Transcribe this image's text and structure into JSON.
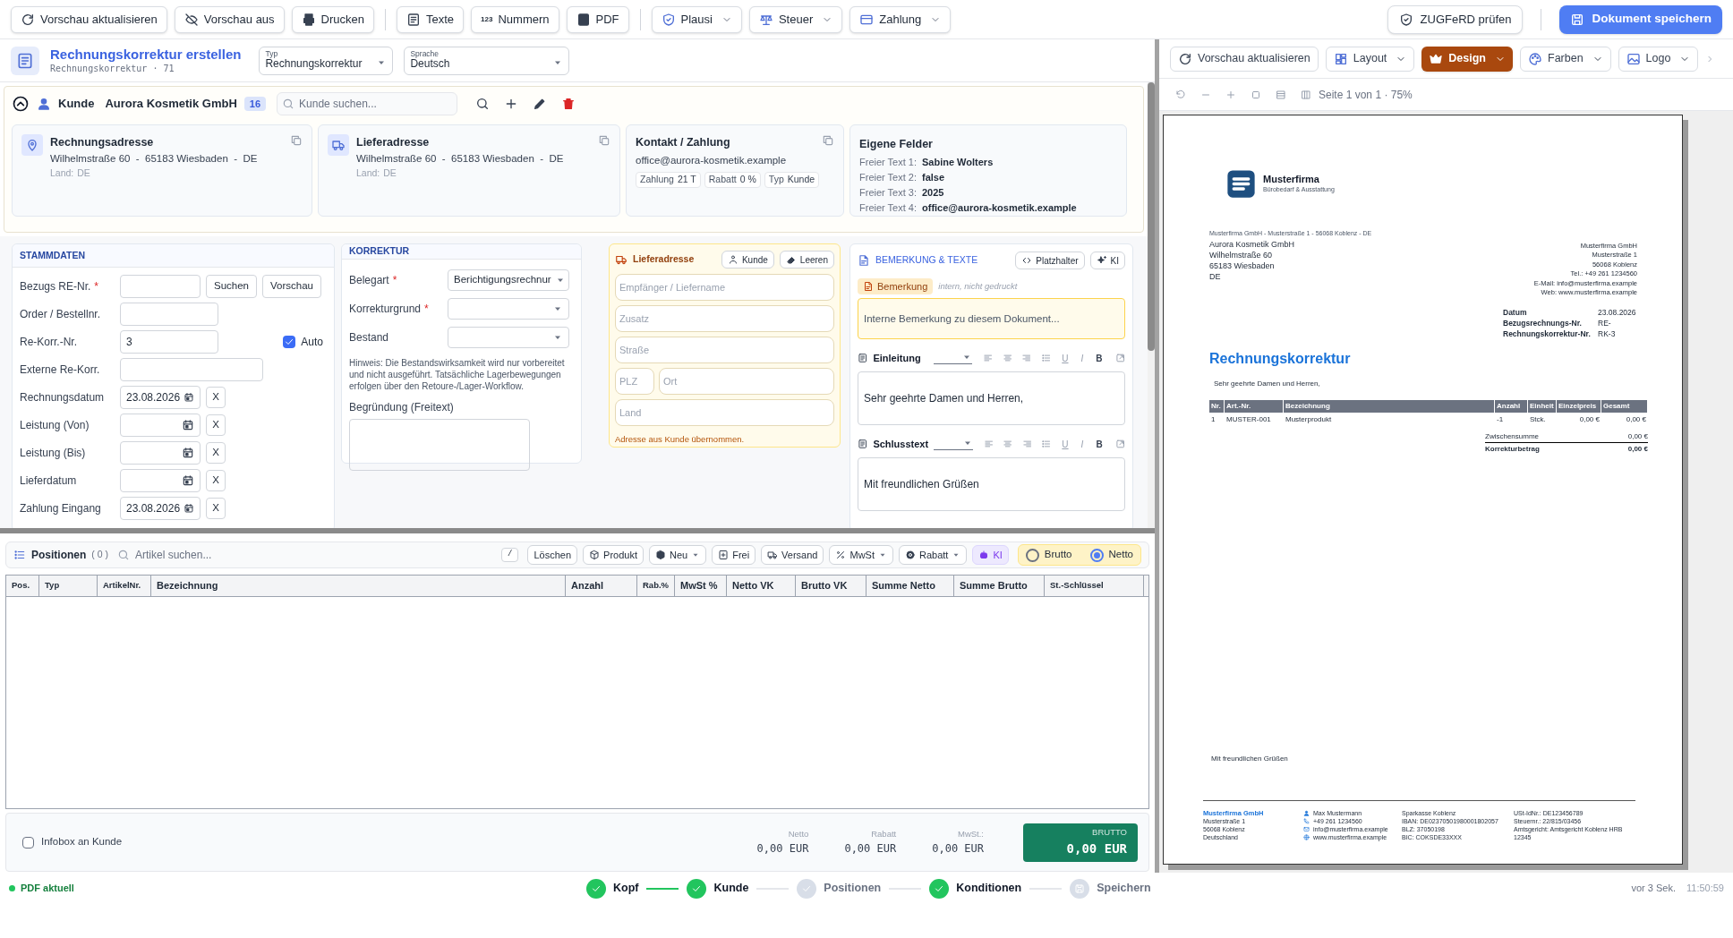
{
  "toolbar": {
    "buttons": [
      {
        "label": "Vorschau aktualisieren",
        "kind": "action"
      },
      {
        "label": "Vorschau aus",
        "kind": "action"
      },
      {
        "label": "Drucken",
        "kind": "action"
      },
      {
        "label": "Texte",
        "kind": "action"
      },
      {
        "label": "Nummern",
        "kind": "action",
        "icon_text": "123"
      },
      {
        "label": "PDF",
        "kind": "action"
      },
      {
        "label": "Plausi",
        "kind": "menu"
      },
      {
        "label": "Steuer",
        "kind": "menu"
      },
      {
        "label": "Zahlung",
        "kind": "menu"
      }
    ],
    "zugferd_button": "ZUGFeRD prüfen",
    "save_button": "Dokument speichern"
  },
  "header": {
    "title": "Rechnungskorrektur erstellen",
    "subtitle": "Rechnungskorrektur · 71",
    "selects": [
      {
        "label": "Typ",
        "value": "Rechnungskorrektur"
      },
      {
        "label": "Sprache",
        "value": "Deutsch"
      }
    ]
  },
  "customer": {
    "expanded": true,
    "label": "Kunde",
    "name": "Aurora Kosmetik GmbH",
    "count": "16",
    "search_placeholder": "Kunde suchen...",
    "addresses": [
      {
        "title": "Rechnungsadresse",
        "address": "Wilhelmstraße 60  -  65183 Wiesbaden  -  DE",
        "country_label": "Land:",
        "country": "DE"
      },
      {
        "title": "Lieferadresse",
        "address": "Wilhelmstraße 60  -  65183 Wiesbaden  -  DE",
        "country_label": "Land:",
        "country": "DE"
      }
    ],
    "contact": {
      "title": "Kontakt / Zahlung",
      "email": "office@aurora-kosmetik.example",
      "chips": [
        {
          "label": "Zahlung",
          "value": "21 T"
        },
        {
          "label": "Rabatt",
          "value": "0 %"
        },
        {
          "label": "Typ",
          "value": "Kunde"
        }
      ]
    },
    "custom_fields": {
      "title": "Eigene Felder",
      "fields": [
        {
          "label": "Freier Text 1:",
          "value": "Sabine Wolters"
        },
        {
          "label": "Freier Text 2:",
          "value": "false"
        },
        {
          "label": "Freier Text 3:",
          "value": "2025"
        },
        {
          "label": "Freier Text 4:",
          "value": "office@aurora-kosmetik.example"
        }
      ]
    }
  },
  "master_data": {
    "title": "STAMMDATEN",
    "rows": [
      {
        "kind": "lookup",
        "label": "Bezugs RE-Nr.",
        "required_mark": "*",
        "buttons": [
          "Suchen",
          "Vorschau"
        ]
      },
      {
        "kind": "text",
        "label": "Order / Bestellnr."
      },
      {
        "kind": "counter",
        "label": "Re-Korr.-Nr.",
        "value": "3",
        "auto": {
          "label": "Auto",
          "checked": true
        }
      },
      {
        "kind": "long_text",
        "label": "Externe Re-Korr."
      },
      {
        "kind": "date",
        "label": "Rechnungsdatum",
        "value": "23.08.2026",
        "clear": "X"
      },
      {
        "kind": "date",
        "label": "Leistung (Von)",
        "clear": "X"
      },
      {
        "kind": "date",
        "label": "Leistung (Bis)",
        "clear": "X"
      },
      {
        "kind": "date",
        "label": "Lieferdatum",
        "clear": "X"
      },
      {
        "kind": "date",
        "label": "Zahlung Eingang",
        "value": "23.08.2026",
        "clear": "X"
      }
    ]
  },
  "correction": {
    "title": "KORREKTUR",
    "selects": [
      {
        "label": "Belegart",
        "required_mark": "*",
        "value": "Berichtigungsrechnur"
      },
      {
        "label": "Korrekturgrund",
        "required_mark": "*"
      },
      {
        "label": "Bestand"
      }
    ],
    "hint": "Hinweis: Die Bestandswirksamkeit wird nur vorbereitet und nicht ausgeführt. Tatsächliche Lagerbewegungen erfolgen über den Retoure-/Lager-Workflow.",
    "reason_label": "Begründung (Freitext)"
  },
  "delivery_address": {
    "title": "Lieferadresse",
    "buttons": [
      "Kunde",
      "Leeren"
    ],
    "rows": [
      [
        {
          "placeholder": "Empfänger / Liefername"
        }
      ],
      [
        {
          "placeholder": "Zusatz"
        }
      ],
      [
        {
          "placeholder": "Straße"
        }
      ],
      [
        {
          "placeholder": "PLZ"
        },
        {
          "placeholder": "Ort"
        }
      ],
      [
        {
          "placeholder": "Land"
        }
      ]
    ],
    "note": "Adresse aus Kunde übernommen."
  },
  "remarks": {
    "title": "BEMERKUNG & TEXTE",
    "buttons": [
      "Platzhalter",
      "KI"
    ],
    "tag": "Bemerkung",
    "tag_hint": "intern, nicht gedruckt",
    "placeholder": "Interne Bemerkung zu diesem Dokument...",
    "editors": [
      {
        "label": "Einleitung",
        "format_buttons": [
          "U",
          "I",
          "B"
        ],
        "text": "Sehr geehrte Damen und Herren,"
      },
      {
        "label": "Schlusstext",
        "format_buttons": [
          "U",
          "I",
          "B"
        ],
        "text": "Mit freundlichen Grüßen"
      }
    ]
  },
  "positions": {
    "title": "Positionen",
    "count": "( 0 )",
    "search_placeholder": "Artikel suchen...",
    "shortcut": "/",
    "buttons": [
      {
        "label": "Löschen",
        "kind": "action"
      },
      {
        "label": "Produkt",
        "kind": "action"
      },
      {
        "label": "Neu",
        "kind": "menu"
      },
      {
        "label": "Frei",
        "kind": "action"
      },
      {
        "label": "Versand",
        "kind": "action"
      },
      {
        "label": "MwSt",
        "kind": "menu"
      },
      {
        "label": "Rabatt",
        "kind": "menu"
      },
      {
        "label": "KI",
        "kind": "ai"
      }
    ],
    "price_mode": [
      {
        "label": "Brutto",
        "selected": false
      },
      {
        "label": "Netto",
        "selected": true
      }
    ],
    "columns": [
      "Pos.",
      "Typ",
      "ArtikelNr.",
      "Bezeichnung",
      "Anzahl",
      "Rab.%",
      "MwSt %",
      "Netto VK",
      "Brutto VK",
      "Summe Netto",
      "Summe Brutto",
      "St.-Schlüssel"
    ],
    "infobox": {
      "label": "Infobox an Kunde",
      "checked": false
    },
    "totals": [
      {
        "label": "Netto",
        "value": "0,00 EUR"
      },
      {
        "label": "Rabatt",
        "value": "0,00 EUR"
      },
      {
        "label": "MwSt.:",
        "value": "0,00 EUR"
      }
    ],
    "gross": {
      "label": "BRUTTO",
      "value": "0,00 EUR"
    }
  },
  "preview": {
    "buttons": [
      {
        "label": "Vorschau aktualisieren",
        "kind": "action",
        "selected": false
      },
      {
        "label": "Layout",
        "kind": "menu",
        "selected": false
      },
      {
        "label": "Design",
        "kind": "menu",
        "selected": true
      },
      {
        "label": "Farben",
        "kind": "menu",
        "selected": false
      },
      {
        "label": "Logo",
        "kind": "menu",
        "selected": false
      }
    ],
    "page_info": "Seite 1 von 1 · 75%",
    "document": {
      "company": "Musterfirma",
      "tagline": "Bürobedarf & Ausstattung",
      "sender_line": "Musterfirma GmbH - Musterstraße 1 - 56068 Koblenz - DE",
      "recipient": [
        "Aurora Kosmetik GmbH",
        "Wilhelmstraße 60",
        "65183 Wiesbaden",
        "DE"
      ],
      "company_block": [
        "Musterfirma GmbH",
        "Musterstraße 1",
        "56068 Koblenz",
        "Tel.: +49 261 1234560",
        "E-Mail: info@musterfirma.example",
        "Web: www.musterfirma.example"
      ],
      "meta": [
        {
          "label": "Datum",
          "value": "23.08.2026"
        },
        {
          "label": "Bezugsrechnungs-Nr.",
          "value": "RE-"
        },
        {
          "label": "Rechnungskorrektur-Nr.",
          "value": "RK-3"
        }
      ],
      "title": "Rechnungskorrektur",
      "greeting": "Sehr geehrte Damen und Herren,",
      "table": {
        "columns": [
          "Nr.",
          "Art.-Nr.",
          "Bezeichnung",
          "Anzahl",
          "Einheit",
          "Einzelpreis",
          "Gesamt"
        ],
        "rows": [
          [
            "1",
            "MUSTER-001",
            "Musterprodukt",
            "-1",
            "Stck.",
            "0,00 €",
            "0,00 €"
          ]
        ]
      },
      "totals": [
        {
          "label": "Zwischensumme",
          "value": "0,00 €",
          "kind": "subtotal"
        },
        {
          "label": "Korrekturbetrag",
          "value": "0,00 €",
          "kind": "total"
        }
      ],
      "closing": "Mit freundlichen Grüßen",
      "footer": [
        {
          "kind": "company",
          "lines": [
            "Musterfirma GmbH",
            "Musterstraße 1",
            "56068 Koblenz",
            "Deutschland"
          ]
        },
        {
          "kind": "contact",
          "lines": [
            "Max Mustermann",
            "+49 261 1234560",
            "info@musterfirma.example",
            "www.musterfirma.example"
          ]
        },
        {
          "kind": "bank",
          "lines": [
            "Sparkasse Koblenz",
            "IBAN: DE02370501980001802057",
            "BLZ: 37050198",
            "BIC: COKSDE33XXX"
          ]
        },
        {
          "kind": "legal",
          "lines": [
            "USt-IdNr.: DE123456789",
            "Steuernr.: 22/815/03456",
            "Amtsgericht: Amtsgericht Koblenz HRB 12345"
          ]
        }
      ]
    }
  },
  "status_bar": {
    "pdf_status": "PDF aktuell",
    "steps": [
      {
        "label": "Kopf",
        "done": true,
        "kind": "step"
      },
      {
        "label": "Kunde",
        "done": true,
        "kind": "step"
      },
      {
        "label": "Positionen",
        "done": false,
        "kind": "step"
      },
      {
        "label": "Konditionen",
        "done": true,
        "kind": "step"
      },
      {
        "label": "Speichern",
        "done": false,
        "kind": "save"
      }
    ],
    "saved_ago": "vor 3 Sek.",
    "time": "11:50:59"
  }
}
